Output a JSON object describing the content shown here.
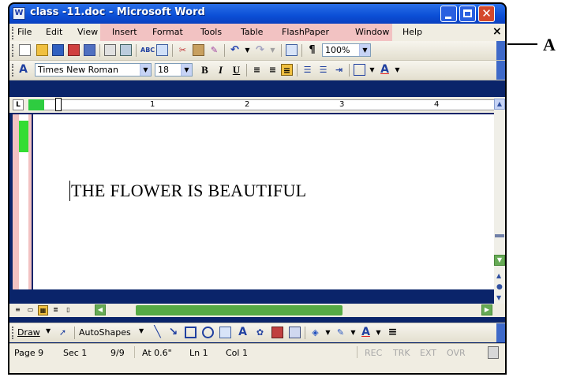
{
  "window": {
    "title": "class -11.doc - Microsoft Word",
    "app_icon_letter": "W"
  },
  "menubar": {
    "items": [
      "File",
      "Edit",
      "View",
      "Insert",
      "Format",
      "Tools",
      "Table",
      "FlashPaper",
      "Window",
      "Help"
    ],
    "close_glyph": "×"
  },
  "standard_toolbar": {
    "zoom": "100%",
    "paragraph_mark": "¶"
  },
  "formatting_toolbar": {
    "style_icon": "A",
    "font": "Times New Roman",
    "size": "18",
    "bold": "B",
    "italic": "I",
    "underline": "U",
    "font_color": "A"
  },
  "ruler": {
    "corner": "L",
    "numbers": [
      "1",
      "2",
      "3",
      "4"
    ]
  },
  "document": {
    "text": "THE FLOWER IS BEAUTIFUL"
  },
  "drawing_toolbar": {
    "draw": "Draw",
    "autoshapes": "AutoShapes",
    "font_color": "A"
  },
  "statusbar": {
    "page": "Page 9",
    "section": "Sec 1",
    "page_of": "9/9",
    "at": "At 0.6\"",
    "line": "Ln 1",
    "col": "Col 1",
    "modes": [
      "REC",
      "TRK",
      "EXT",
      "OVR"
    ]
  },
  "callout": {
    "label": "A"
  },
  "colors": {
    "titlebar": "#0b4fd6",
    "highlight_pink": "#f2c2c2",
    "scroll_green": "#56aa44",
    "ruler_green": "#2ecc40"
  }
}
